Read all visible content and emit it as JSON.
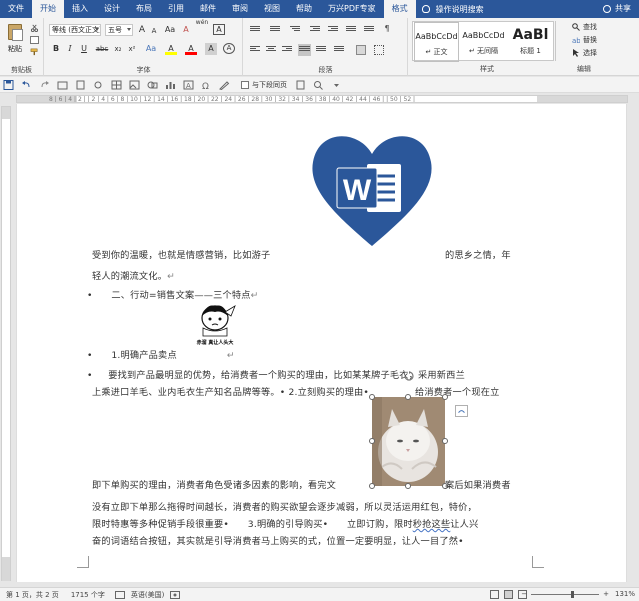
{
  "tabs": [
    {
      "label": "文件"
    },
    {
      "label": "开始"
    },
    {
      "label": "插入"
    },
    {
      "label": "设计"
    },
    {
      "label": "布局"
    },
    {
      "label": "引用"
    },
    {
      "label": "邮件"
    },
    {
      "label": "审阅"
    },
    {
      "label": "视图"
    },
    {
      "label": "帮助"
    },
    {
      "label": "万兴PDF专家"
    },
    {
      "label": "格式"
    }
  ],
  "tell_me": "操作说明搜索",
  "share": "共享",
  "ribbon": {
    "clipboard": {
      "paste": "粘贴",
      "label": "剪贴板"
    },
    "font": {
      "font_name": "等线 (西文正文)",
      "font_size": "五号",
      "wen": "wén",
      "label": "字体",
      "bold": "B",
      "italic": "I",
      "underline": "U",
      "strike": "abc",
      "sub": "x₂",
      "sup": "x²",
      "grow": "A",
      "shrink": "A",
      "case": "Aa",
      "clear": "A",
      "hilite": "A",
      "color": "A",
      "charbox": "A"
    },
    "paragraph": {
      "label": "段落"
    },
    "styles": {
      "label": "样式",
      "items": [
        {
          "preview": "AaBbCcDd",
          "name": "↵ 正文"
        },
        {
          "preview": "AaBbCcDd",
          "name": "↵ 无间隔"
        },
        {
          "preview": "AaBl",
          "name": "标题 1"
        }
      ]
    },
    "editing": {
      "label": "编辑",
      "find": "查找",
      "replace": "替换",
      "select": "选择"
    }
  },
  "qat": {
    "checkbox_label": "与下段同页"
  },
  "ruler_text": "8 | 6 | 4 | 2 | | 2 | 4 | 6 | 8 | 10 | 12 | 14 | 16 | 18 | 20 | 22 | 24 | 26 | 28 | 30 | 32 | 34 | 36 | 38 | 40 | 42 | 44 | 46 | | 50 | 52 |",
  "document": {
    "line1": "受到你的温暖，也就是情感营销，比如游子",
    "line1_tail": "的思乡之情，年",
    "line2": "轻人的潮流文化。",
    "bullet1": "二、行动=销售文案——三个特点",
    "sticker_text": "赤溜 真让人头大",
    "bullet2": "1.明确产品卖点",
    "bullet3": "要找到产品最明显的优势，给消费者一个购买的理由，比如某某牌子毛衣，采用新西兰",
    "line3": "上乘进口羊毛、业内毛衣生产知名品牌等等。• 2.立刻购买的理由•",
    "line3_tail": "给消费者一个现在立",
    "line4": "即下单购买的理由，消费者角色受诸多因素的影响，看完文",
    "line4_tail": "案后如果消费者",
    "line5": "没有立即下单那么拖得时间越长，消费者的购买欲望会逐步减弱，所以灵活运用红包，特价，",
    "line6": "限时特惠等多种促销手段很重要•",
    "line6_b": "3.明确的引导购买•",
    "line6_c": "立即订购，限时",
    "line6_d": "秒抢这些",
    "line6_e": "让人兴",
    "line7": "奋的词语结合按钮，其实就是引导消费者马上购买的式，位置一定要明显，让人一目了然•"
  },
  "status": {
    "page": "第 1 页，共 2 页",
    "words": "1715 个字",
    "lang": "英语(美国)",
    "zoom": "131%"
  },
  "colors": {
    "accent": "#2b579a",
    "ribbon_bg": "#f3f3f3",
    "word_blue": "#2b579a"
  }
}
